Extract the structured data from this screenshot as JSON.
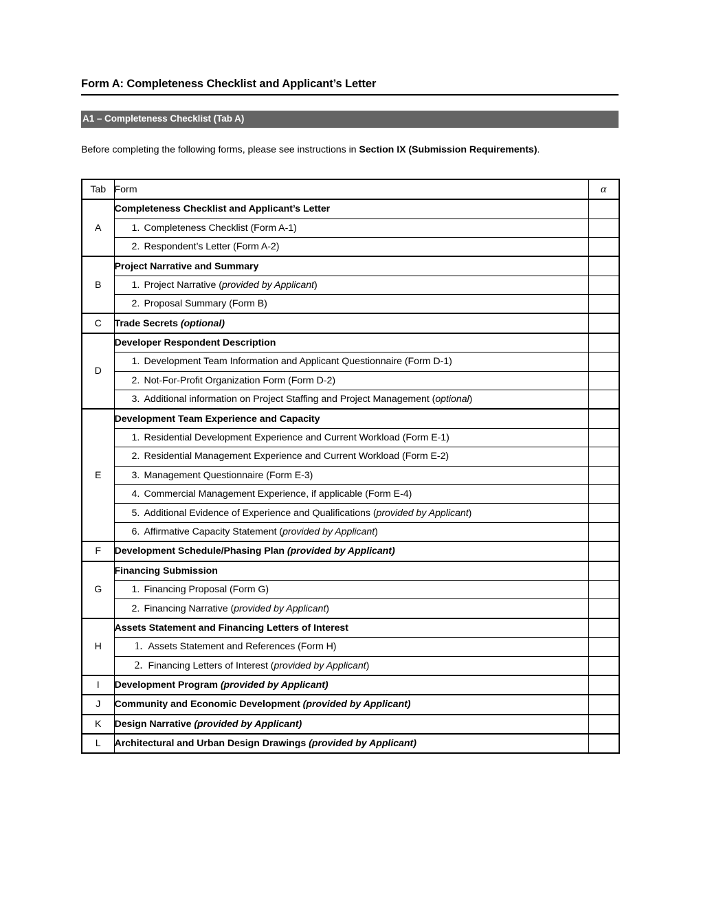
{
  "document": {
    "title": "Form A: Completeness Checklist and Applicant’s Letter",
    "section_banner": "A1 – Completeness Checklist (Tab A)",
    "intro_before": "Before completing the following forms, please see instructions in ",
    "intro_bold": "Section IX (Submission Requirements)",
    "intro_after": ".",
    "banner_color": "#646464"
  },
  "table": {
    "headers": {
      "tab": "Tab",
      "form": "Form",
      "alpha": "α"
    },
    "rows": [
      {
        "tab": "A",
        "span": 3,
        "type": "group",
        "text": "Completeness Checklist and Applicant’s Letter"
      },
      {
        "type": "sub",
        "num": "1.",
        "text": "Completeness Checklist (Form A-1)"
      },
      {
        "type": "sub",
        "num": "2.",
        "text": "Respondent’s Letter (Form A-2)"
      },
      {
        "tab": "B",
        "span": 3,
        "type": "group",
        "text": "Project Narrative and Summary"
      },
      {
        "type": "sub",
        "num": "1.",
        "text": "Project Narrative (",
        "ital": "provided by Applicant",
        "tail": ")"
      },
      {
        "type": "sub",
        "num": "2.",
        "text": "Proposal Summary (Form B)"
      },
      {
        "tab": "C",
        "span": 1,
        "type": "group",
        "text": "Trade Secrets ",
        "ital": "(optional)"
      },
      {
        "tab": "D",
        "span": 4,
        "type": "group",
        "text": "Developer Respondent Description"
      },
      {
        "type": "sub",
        "num": "1.",
        "text": "Development Team Information and Applicant Questionnaire (Form D-1)"
      },
      {
        "type": "sub",
        "num": "2.",
        "text": "Not-For-Profit Organization Form (Form D-2)"
      },
      {
        "type": "sub",
        "num": "3.",
        "text": "Additional information on Project Staffing and Project Management  (",
        "ital": "optional",
        "tail": ")"
      },
      {
        "tab": "E",
        "span": 7,
        "type": "group",
        "text": "Development Team Experience and Capacity"
      },
      {
        "type": "sub",
        "num": "1.",
        "text": "Residential Development Experience and Current Workload (Form E-1)"
      },
      {
        "type": "sub",
        "num": "2.",
        "text": "Residential Management Experience and Current Workload (Form E-2)"
      },
      {
        "type": "sub",
        "num": "3.",
        "text": "Management Questionnaire (Form E-3)"
      },
      {
        "type": "sub",
        "num": "4.",
        "text": "Commercial Management Experience, if applicable (Form E-4)"
      },
      {
        "type": "sub",
        "num": "5.",
        "text": "Additional Evidence of Experience and Qualifications (",
        "ital": "provided by Applicant",
        "tail": ")"
      },
      {
        "type": "sub",
        "num": "6.",
        "text": "Affirmative Capacity Statement (",
        "ital": "provided by Applicant",
        "tail": ")"
      },
      {
        "tab": "F",
        "span": 1,
        "type": "group",
        "text": "Development Schedule/Phasing Plan ",
        "ital": "(provided by Applicant)"
      },
      {
        "tab": "G",
        "span": 3,
        "type": "group",
        "text": "Financing Submission"
      },
      {
        "type": "sub",
        "num": "1.",
        "text": "Financing Proposal (Form G)"
      },
      {
        "type": "sub",
        "num": "2.",
        "text": "Financing Narrative (",
        "ital": "provided by Applicant",
        "tail": ")"
      },
      {
        "tab": "H",
        "span": 3,
        "type": "group",
        "text": "Assets Statement and Financing Letters of Interest"
      },
      {
        "type": "sub",
        "serif": true,
        "num": "1.",
        "text": "Assets Statement and References (Form H)"
      },
      {
        "type": "sub",
        "serif": true,
        "num": "2.",
        "text": "Financing Letters of Interest (",
        "ital": "provided by Applicant",
        "tail": ")"
      },
      {
        "tab": "I",
        "span": 1,
        "type": "group",
        "text": "Development Program ",
        "ital": "(provided by Applicant)"
      },
      {
        "tab": "J",
        "span": 1,
        "type": "group",
        "text": "Community and Economic Development ",
        "ital": "(provided by Applicant)"
      },
      {
        "tab": "K",
        "span": 1,
        "type": "group",
        "text": "Design Narrative ",
        "ital": "(provided by Applicant)"
      },
      {
        "tab": "L",
        "span": 1,
        "type": "group",
        "text": "Architectural and Urban Design Drawings ",
        "ital": "(provided by Applicant)"
      }
    ]
  }
}
